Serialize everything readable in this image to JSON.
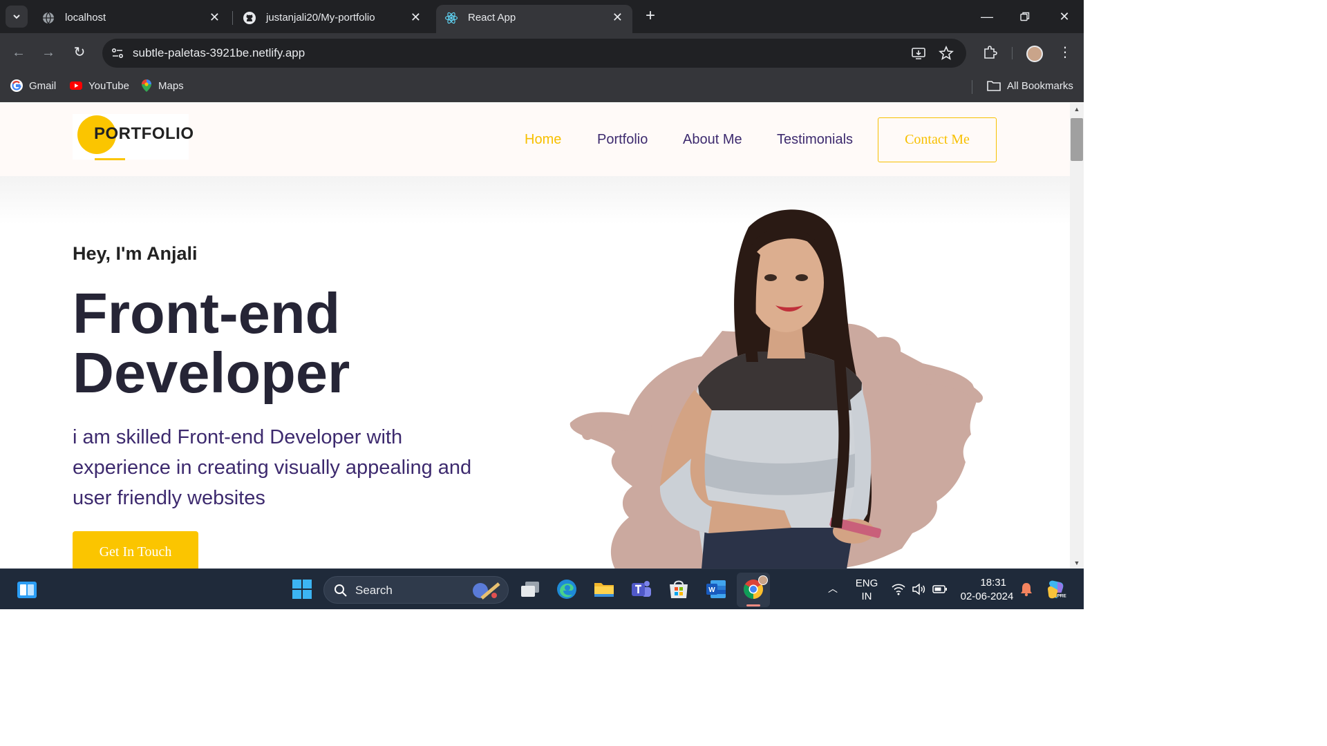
{
  "browser": {
    "tabs": [
      {
        "title": "localhost",
        "icon": "globe-icon",
        "active": false
      },
      {
        "title": "justanjali20/My-portfolio",
        "icon": "github-icon",
        "active": false
      },
      {
        "title": "React App",
        "icon": "react-icon",
        "active": true
      }
    ],
    "url": "subtle-paletas-3921be.netlify.app",
    "bookmarks": [
      {
        "label": "Gmail",
        "icon": "google-icon"
      },
      {
        "label": "YouTube",
        "icon": "youtube-icon"
      },
      {
        "label": "Maps",
        "icon": "maps-icon"
      }
    ],
    "all_bookmarks": "All Bookmarks"
  },
  "site": {
    "logo": "PORTFOLIO",
    "nav": [
      "Home",
      "Portfolio",
      "About Me",
      "Testimonials"
    ],
    "contact": "Contact Me",
    "greeting": "Hey, I'm Anjali",
    "headline_line1": "Front-end",
    "headline_line2": "Developer",
    "tagline": "i am skilled Front-end Developer with experience in creating visually appealing and user friendly websites",
    "cta": "Get In Touch",
    "colors": {
      "accent": "#fbc500",
      "heading": "#262536",
      "purple": "#3d2a6e",
      "brush": "#cba99f"
    }
  },
  "taskbar": {
    "search": "Search",
    "lang_top": "ENG",
    "lang_bottom": "IN",
    "time": "18:31",
    "date": "02-06-2024"
  }
}
